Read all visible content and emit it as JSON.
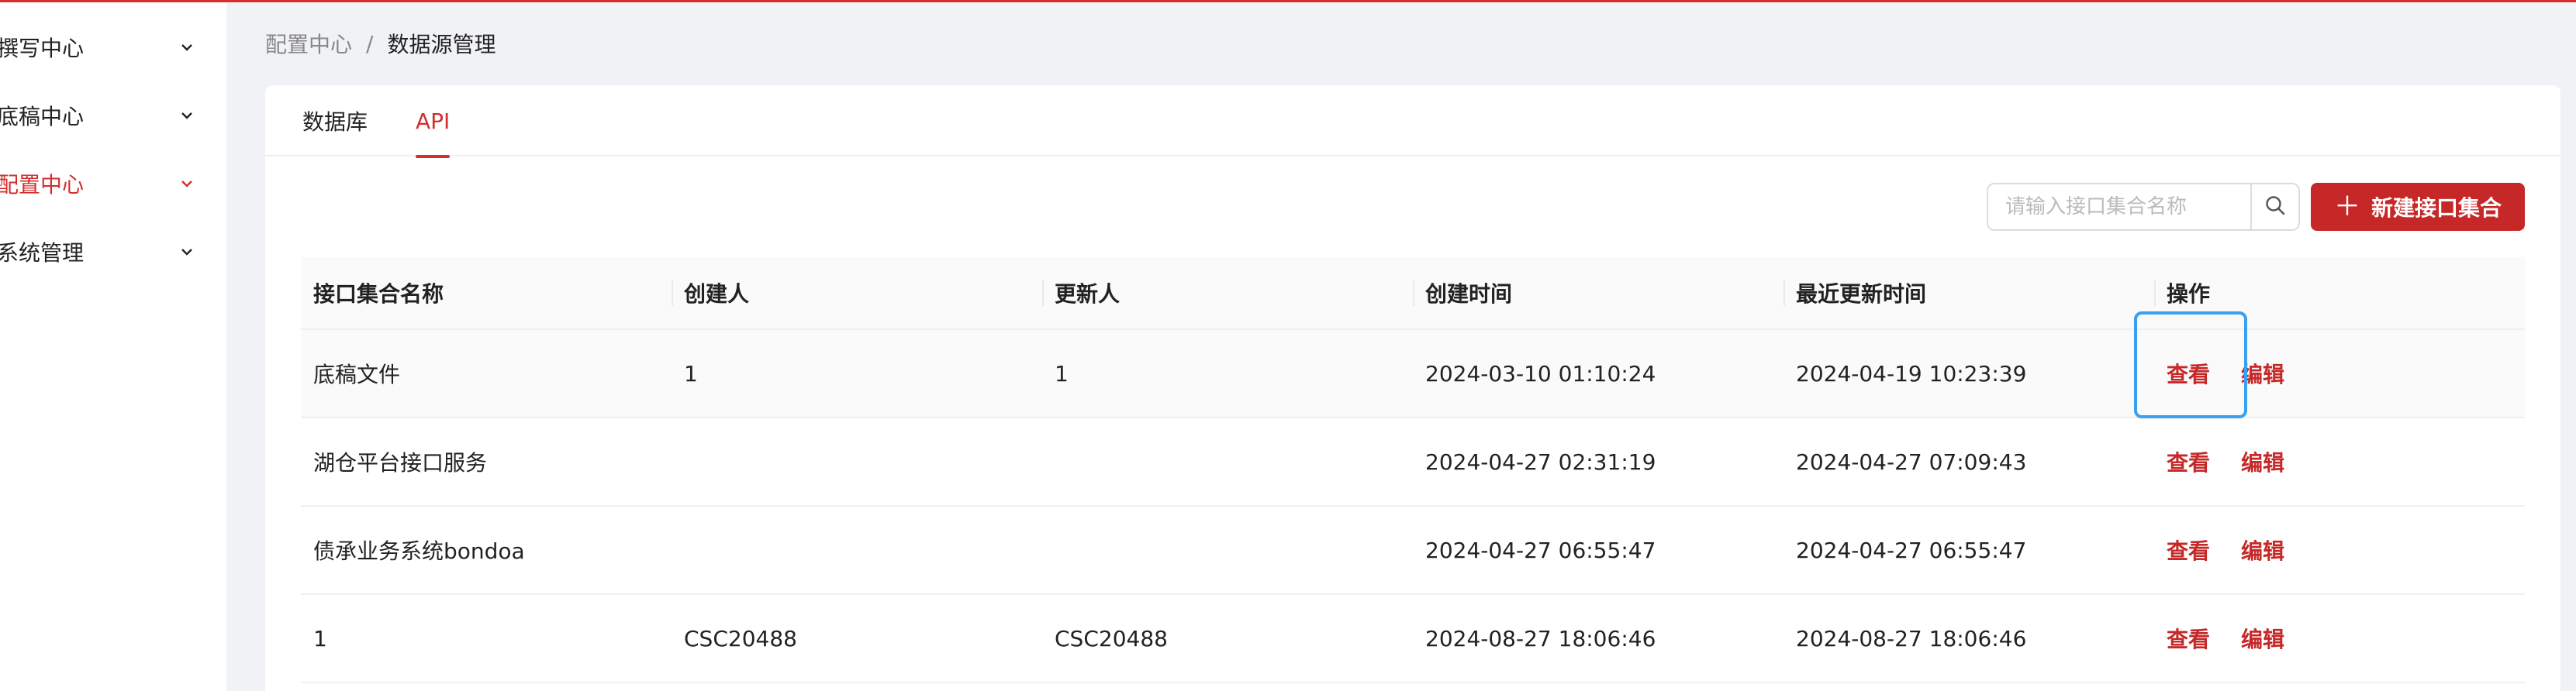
{
  "sidebar": {
    "items": [
      {
        "label": "撰写中心",
        "active": false
      },
      {
        "label": "底稿中心",
        "active": false
      },
      {
        "label": "配置中心",
        "active": true
      },
      {
        "label": "系统管理",
        "active": false
      }
    ]
  },
  "breadcrumb": {
    "parent": "配置中心",
    "separator": "/",
    "current": "数据源管理"
  },
  "tabs": [
    {
      "label": "数据库",
      "active": false
    },
    {
      "label": "API",
      "active": true
    }
  ],
  "toolbar": {
    "search_placeholder": "请输入接口集合名称",
    "search_value": "",
    "new_button_label": "新建接口集合",
    "new_button_icon": "plus-icon"
  },
  "table": {
    "columns": [
      "接口集合名称",
      "创建人",
      "更新人",
      "创建时间",
      "最近更新时间",
      "操作"
    ],
    "rows": [
      {
        "name": "底稿文件",
        "creator": "1",
        "updater": "1",
        "created": "2024-03-10 01:10:24",
        "updated": "2024-04-19 10:23:39"
      },
      {
        "name": "湖仓平台接口服务",
        "creator": "",
        "updater": "",
        "created": "2024-04-27 02:31:19",
        "updated": "2024-04-27 07:09:43"
      },
      {
        "name": "债承业务系统bondoa",
        "creator": "",
        "updater": "",
        "created": "2024-04-27 06:55:47",
        "updated": "2024-04-27 06:55:47"
      },
      {
        "name": "1",
        "creator": "CSC20488",
        "updater": "CSC20488",
        "created": "2024-08-27 18:06:46",
        "updated": "2024-08-27 18:06:46"
      }
    ],
    "action_view": "查看",
    "action_edit": "编辑"
  },
  "colors": {
    "accent": "#c62828",
    "highlight": "#3aa0f0"
  }
}
